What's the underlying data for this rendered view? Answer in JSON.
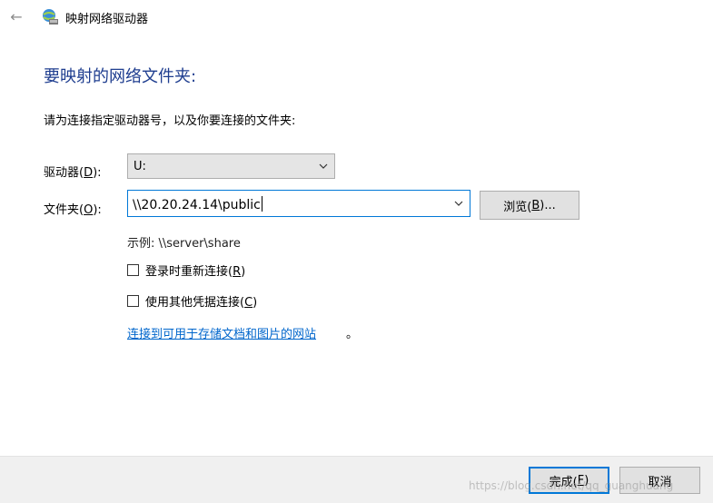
{
  "window": {
    "title": "映射网络驱动器",
    "back_glyph": "←"
  },
  "heading": "要映射的网络文件夹:",
  "instruction": "请为连接指定驱动器号，以及你要连接的文件夹:",
  "drive": {
    "label_prefix": "驱动器(",
    "label_key": "D",
    "label_suffix": "):",
    "value": "U:"
  },
  "folder": {
    "label_prefix": "文件夹(",
    "label_key": "O",
    "label_suffix": "):",
    "value": "\\\\20.20.24.14\\public"
  },
  "browse": {
    "label_prefix": "浏览(",
    "label_key": "B",
    "label_suffix": ")..."
  },
  "example": "示例: \\\\server\\share",
  "reconnect": {
    "label_prefix": "登录时重新连接(",
    "label_key": "R",
    "label_suffix": ")",
    "checked": false
  },
  "other_credentials": {
    "label_prefix": "使用其他凭据连接(",
    "label_key": "C",
    "label_suffix": ")",
    "checked": false
  },
  "link": {
    "text": "连接到可用于存储文档和图片的网站",
    "trailing": "。"
  },
  "footer": {
    "finish": {
      "label_prefix": "完成(",
      "label_key": "F",
      "label_suffix": ")"
    },
    "cancel": "取消"
  },
  "watermark": "https://blog.csdn.net/qq_guanghuang",
  "colors": {
    "heading": "#1e3d8f",
    "link": "#0066cc",
    "accent_border": "#0078d7"
  }
}
